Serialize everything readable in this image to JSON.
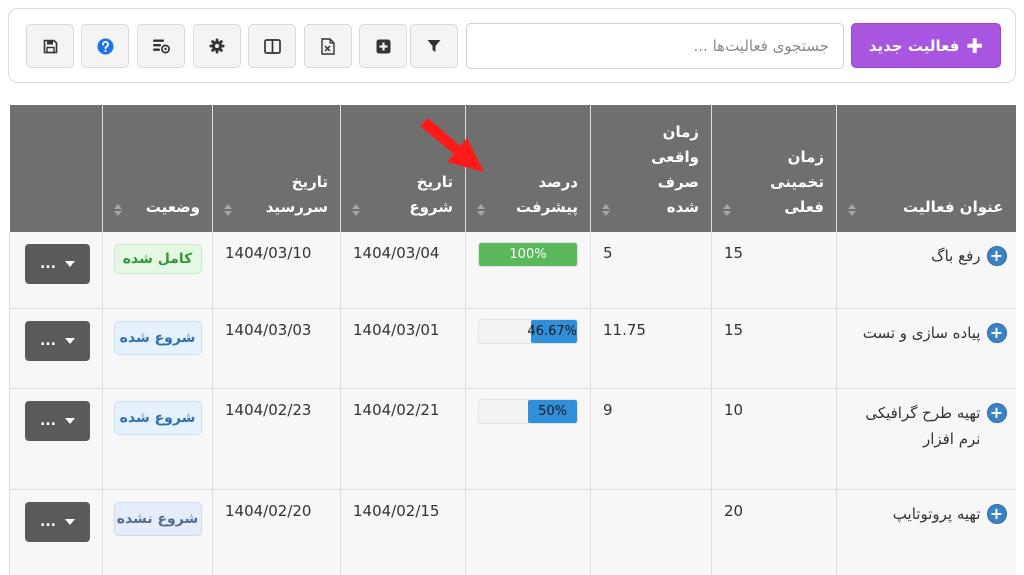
{
  "toolbar": {
    "new_button_label": "فعالیت جدید",
    "search_placeholder": "جستجوی فعالیت‌ها ...",
    "buttons": [
      {
        "icon": "filter-icon"
      },
      {
        "icon": "add-square-icon"
      },
      {
        "icon": "excel-export-icon"
      },
      {
        "icon": "columns-icon"
      },
      {
        "icon": "gear-icon"
      },
      {
        "icon": "column-settings-icon"
      },
      {
        "icon": "help-icon"
      },
      {
        "icon": "save-icon"
      }
    ]
  },
  "table": {
    "columns": [
      {
        "key": "title",
        "label": "عنوان فعالیت"
      },
      {
        "key": "estimated",
        "label": "زمان تخمینی فعلی"
      },
      {
        "key": "actual",
        "label": "زمان واقعی صرف شده"
      },
      {
        "key": "progress",
        "label": "درصد پیشرفت"
      },
      {
        "key": "start",
        "label": "تاریخ شروع"
      },
      {
        "key": "due",
        "label": "تاریخ سررسید"
      },
      {
        "key": "status",
        "label": "وضعیت"
      },
      {
        "key": "actions",
        "label": ""
      }
    ],
    "rows": [
      {
        "title": "رفع باگ",
        "estimated": "15",
        "actual": "5",
        "progress_label": "100%",
        "progress": 1.0,
        "start": "1404/03/04",
        "due": "1404/03/10",
        "status": "کامل شده",
        "status_type": "done",
        "action_label": "..."
      },
      {
        "title": "پیاده سازی و تست",
        "estimated": "15",
        "actual": "11.75",
        "progress_label": "46.67%",
        "progress": 0.4667,
        "start": "1404/03/01",
        "due": "1404/03/03",
        "status": "شروع شده",
        "status_type": "started",
        "action_label": "..."
      },
      {
        "title": "تهیه طرح گرافیکی نرم افزار",
        "estimated": "10",
        "actual": "9",
        "progress_label": "50%",
        "progress": 0.5,
        "start": "1404/02/21",
        "due": "1404/02/23",
        "status": "شروع شده",
        "status_type": "started",
        "action_label": "..."
      },
      {
        "title": "تهیه پروتوتایپ",
        "estimated": "20",
        "actual": "",
        "progress_label": "",
        "progress": null,
        "start": "1404/02/15",
        "due": "1404/02/20",
        "status": "شروع نشده",
        "status_type": "notstarted",
        "action_label": "..."
      }
    ]
  },
  "colors": {
    "primary_purple": "#a855e0",
    "header_gray": "#6f6f6f",
    "progress_complete": "#5cb85c",
    "progress_partial": "#2f8fd8",
    "annotation_arrow": "#ff1a1a"
  }
}
